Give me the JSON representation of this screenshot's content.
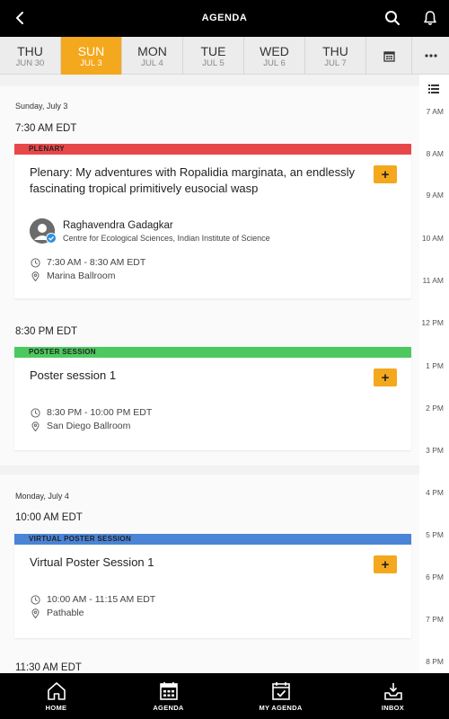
{
  "header": {
    "title": "AGENDA",
    "icons": [
      "back-arrow-icon",
      "search-icon",
      "bell-icon"
    ]
  },
  "days": [
    {
      "dow": "THU",
      "date": "JUN 30",
      "active": false
    },
    {
      "dow": "SUN",
      "date": "JUL 3",
      "active": true
    },
    {
      "dow": "MON",
      "date": "JUL 4",
      "active": false
    },
    {
      "dow": "TUE",
      "date": "JUL 5",
      "active": false
    },
    {
      "dow": "WED",
      "date": "JUL 6",
      "active": false
    },
    {
      "dow": "THU",
      "date": "JUL 7",
      "active": false
    }
  ],
  "rail": {
    "times": [
      "7 AM",
      "8 AM",
      "9 AM",
      "10 AM",
      "11 AM",
      "12 PM",
      "1 PM",
      "2 PM",
      "3 PM",
      "4 PM",
      "5 PM",
      "6 PM",
      "7 PM",
      "8 PM"
    ]
  },
  "sections": [
    {
      "day_heading": "Sunday, July 3",
      "time_heading": "7:30 AM EDT",
      "session": {
        "category": "PLENARY",
        "category_color": "#e8474a",
        "title": "Plenary: My adventures with Ropalidia marginata, an endlessly fascinating tropical primitively eusocial wasp",
        "speaker_name": "Raghavendra Gadagkar",
        "speaker_org": "Centre for Ecological Sciences, Indian Institute of Science",
        "time": "7:30 AM - 8:30 AM EDT",
        "location": "Marina Ballroom"
      }
    },
    {
      "time_heading": "8:30 PM EDT",
      "session": {
        "category": "POSTER SESSION",
        "category_color": "#4cc95e",
        "title": "Poster session 1",
        "time": "8:30 PM - 10:00 PM EDT",
        "location": "San Diego Ballroom"
      }
    },
    {
      "day_heading": "Monday, July 4",
      "time_heading": "10:00 AM EDT",
      "session": {
        "category": "VIRTUAL POSTER SESSION",
        "category_color": "#4a84d6",
        "title": "Virtual Poster Session 1",
        "time": "10:00 AM - 11:15 AM EDT",
        "location": "Pathable"
      }
    },
    {
      "time_heading": "11:30 AM EDT"
    }
  ],
  "add_label": "+",
  "bottom_nav": [
    {
      "label": "HOME",
      "icon": "home-icon"
    },
    {
      "label": "AGENDA",
      "icon": "calendar-icon"
    },
    {
      "label": "MY AGENDA",
      "icon": "calendar-check-icon"
    },
    {
      "label": "INBOX",
      "icon": "inbox-icon"
    }
  ],
  "colors": {
    "accent": "#f4a81d",
    "bar": "#000000"
  }
}
